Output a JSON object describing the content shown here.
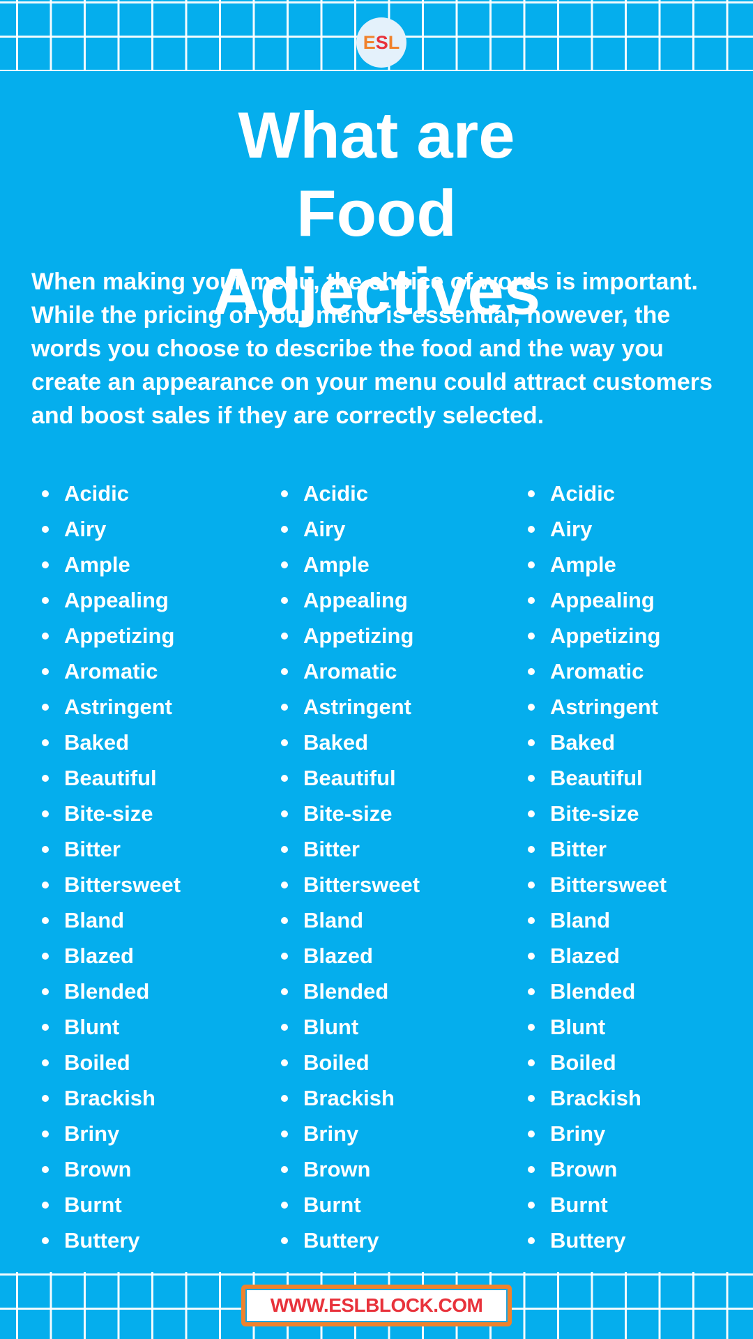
{
  "logo": {
    "letters": [
      "E",
      "S",
      "L"
    ],
    "colors": {
      "orange": "#f0822c",
      "red": "#e8323b"
    }
  },
  "header": {
    "title": "What are Food Adjectives"
  },
  "intro": "When making your menu, the choice of words is important. While the pricing of your menu is essential, however, the words you choose to describe the food and the way you create an appearance on your menu could attract customers and boost sales if they are correctly selected.",
  "columns": [
    [
      "Acidic",
      "Airy",
      "Ample",
      "Appealing",
      "Appetizing",
      "Aromatic",
      "Astringent",
      "Baked",
      "Beautiful",
      "Bite-size",
      "Bitter",
      "Bittersweet",
      "Bland",
      "Blazed",
      "Blended",
      "Blunt",
      "Boiled",
      "Brackish",
      "Briny",
      "Brown",
      "Burnt",
      "Buttery"
    ],
    [
      "Acidic",
      "Airy",
      "Ample",
      "Appealing",
      "Appetizing",
      "Aromatic",
      "Astringent",
      "Baked",
      "Beautiful",
      "Bite-size",
      "Bitter",
      "Bittersweet",
      "Bland",
      "Blazed",
      "Blended",
      "Blunt",
      "Boiled",
      "Brackish",
      "Briny",
      "Brown",
      "Burnt",
      "Buttery"
    ],
    [
      "Acidic",
      "Airy",
      "Ample",
      "Appealing",
      "Appetizing",
      "Aromatic",
      "Astringent",
      "Baked",
      "Beautiful",
      "Bite-size",
      "Bitter",
      "Bittersweet",
      "Bland",
      "Blazed",
      "Blended",
      "Blunt",
      "Boiled",
      "Brackish",
      "Briny",
      "Brown",
      "Burnt",
      "Buttery"
    ]
  ],
  "footer": {
    "url": "WWW.ESLBLOCK.COM"
  },
  "theme": {
    "background": "#05aeed",
    "text": "#ffffff",
    "url_text": "#e8323b",
    "url_border": "#f0822c"
  }
}
